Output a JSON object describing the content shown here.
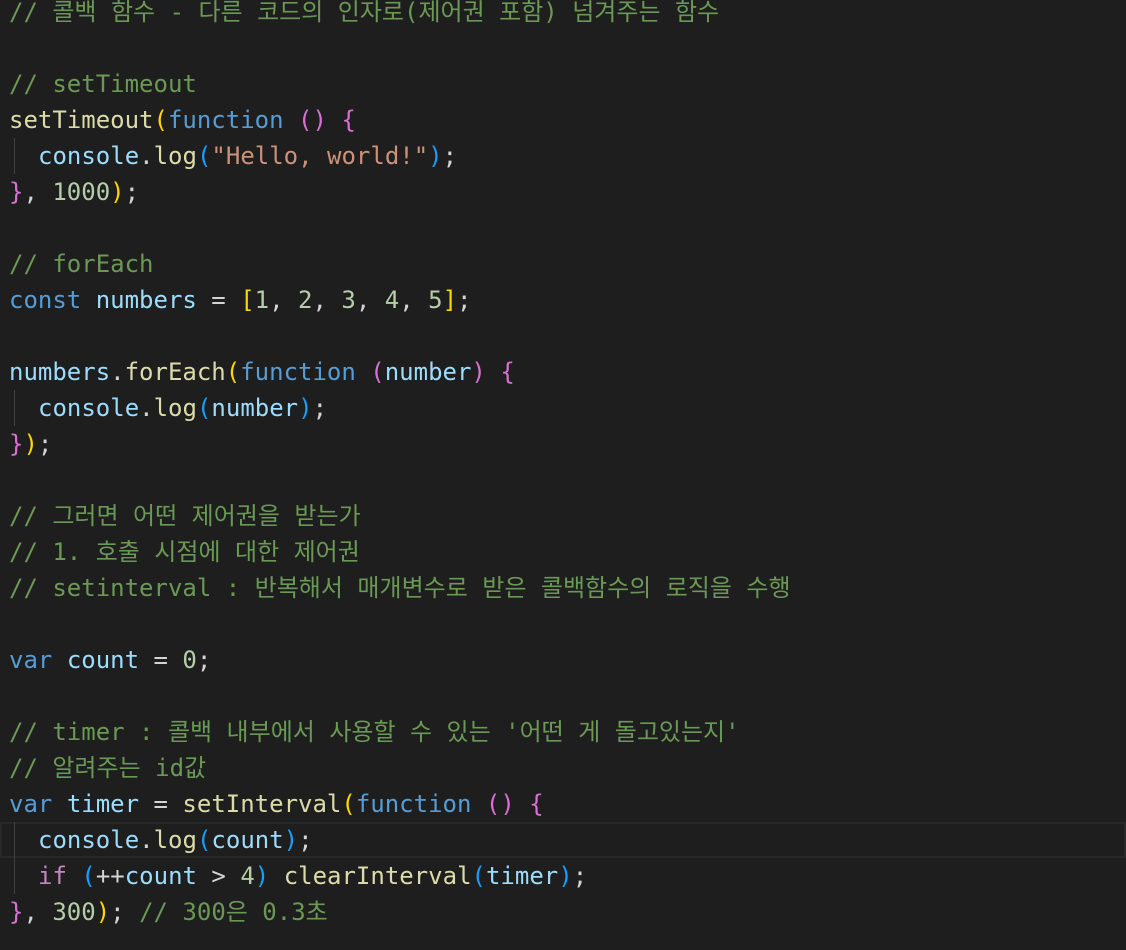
{
  "lines": [
    [
      {
        "t": "// 콜백 함수 - 다른 코드의 인자로(제어권 포함) 넘겨주는 함수",
        "c": "c"
      }
    ],
    [],
    [
      {
        "t": "// setTimeout",
        "c": "c"
      }
    ],
    [
      {
        "t": "setTimeout",
        "c": "f"
      },
      {
        "t": "(",
        "c": "b1"
      },
      {
        "t": "function",
        "c": "k"
      },
      {
        "t": " "
      },
      {
        "t": "()",
        "c": "b2"
      },
      {
        "t": " "
      },
      {
        "t": "{",
        "c": "b2"
      }
    ],
    [
      {
        "t": "console",
        "c": "v"
      },
      {
        "t": "."
      },
      {
        "t": "log",
        "c": "f"
      },
      {
        "t": "(",
        "c": "b3"
      },
      {
        "t": "\"Hello, world!\"",
        "c": "s"
      },
      {
        "t": ")",
        "c": "b3"
      },
      {
        "t": ";"
      }
    ],
    [
      {
        "t": "}",
        "c": "b2"
      },
      {
        "t": ", "
      },
      {
        "t": "1000",
        "c": "n"
      },
      {
        "t": ")",
        "c": "b1"
      },
      {
        "t": ";"
      }
    ],
    [],
    [
      {
        "t": "// forEach",
        "c": "c"
      }
    ],
    [
      {
        "t": "const",
        "c": "k"
      },
      {
        "t": " "
      },
      {
        "t": "numbers",
        "c": "v"
      },
      {
        "t": " = "
      },
      {
        "t": "[",
        "c": "b1"
      },
      {
        "t": "1",
        "c": "n"
      },
      {
        "t": ", "
      },
      {
        "t": "2",
        "c": "n"
      },
      {
        "t": ", "
      },
      {
        "t": "3",
        "c": "n"
      },
      {
        "t": ", "
      },
      {
        "t": "4",
        "c": "n"
      },
      {
        "t": ", "
      },
      {
        "t": "5",
        "c": "n"
      },
      {
        "t": "]",
        "c": "b1"
      },
      {
        "t": ";"
      }
    ],
    [],
    [
      {
        "t": "numbers",
        "c": "v"
      },
      {
        "t": "."
      },
      {
        "t": "forEach",
        "c": "f"
      },
      {
        "t": "(",
        "c": "b1"
      },
      {
        "t": "function",
        "c": "k"
      },
      {
        "t": " "
      },
      {
        "t": "(",
        "c": "b2"
      },
      {
        "t": "number",
        "c": "v"
      },
      {
        "t": ")",
        "c": "b2"
      },
      {
        "t": " "
      },
      {
        "t": "{",
        "c": "b2"
      }
    ],
    [
      {
        "t": "console",
        "c": "v"
      },
      {
        "t": "."
      },
      {
        "t": "log",
        "c": "f"
      },
      {
        "t": "(",
        "c": "b3"
      },
      {
        "t": "number",
        "c": "v"
      },
      {
        "t": ")",
        "c": "b3"
      },
      {
        "t": ";"
      }
    ],
    [
      {
        "t": "}",
        "c": "b2"
      },
      {
        "t": ")",
        "c": "b1"
      },
      {
        "t": ";"
      }
    ],
    [],
    [
      {
        "t": "// 그러면 어떤 제어권을 받는가",
        "c": "c"
      }
    ],
    [
      {
        "t": "// 1. 호출 시점에 대한 제어권",
        "c": "c"
      }
    ],
    [
      {
        "t": "// setinterval : 반복해서 매개변수로 받은 콜백함수의 로직을 수행",
        "c": "c"
      }
    ],
    [],
    [
      {
        "t": "var",
        "c": "k"
      },
      {
        "t": " "
      },
      {
        "t": "count",
        "c": "v"
      },
      {
        "t": " = "
      },
      {
        "t": "0",
        "c": "n"
      },
      {
        "t": ";"
      }
    ],
    [],
    [
      {
        "t": "// timer : 콜백 내부에서 사용할 수 있는 '어떤 게 돌고있는지'",
        "c": "c"
      }
    ],
    [
      {
        "t": "// 알려주는 id값",
        "c": "c"
      }
    ],
    [
      {
        "t": "var",
        "c": "k"
      },
      {
        "t": " "
      },
      {
        "t": "timer",
        "c": "v"
      },
      {
        "t": " = "
      },
      {
        "t": "setInterval",
        "c": "f"
      },
      {
        "t": "(",
        "c": "b1"
      },
      {
        "t": "function",
        "c": "k"
      },
      {
        "t": " "
      },
      {
        "t": "()",
        "c": "b2"
      },
      {
        "t": " "
      },
      {
        "t": "{",
        "c": "b2"
      }
    ],
    [
      {
        "t": "console",
        "c": "v"
      },
      {
        "t": "."
      },
      {
        "t": "log",
        "c": "f"
      },
      {
        "t": "(",
        "c": "b3"
      },
      {
        "t": "count",
        "c": "v"
      },
      {
        "t": ")",
        "c": "b3"
      },
      {
        "t": ";"
      }
    ],
    [
      {
        "t": "if",
        "c": "ctl"
      },
      {
        "t": " "
      },
      {
        "t": "(",
        "c": "b3"
      },
      {
        "t": "++",
        "c": "p"
      },
      {
        "t": "count",
        "c": "v"
      },
      {
        "t": " > "
      },
      {
        "t": "4",
        "c": "n"
      },
      {
        "t": ")",
        "c": "b3"
      },
      {
        "t": " "
      },
      {
        "t": "clearInterval",
        "c": "f"
      },
      {
        "t": "(",
        "c": "b3"
      },
      {
        "t": "timer",
        "c": "v"
      },
      {
        "t": ")",
        "c": "b3"
      },
      {
        "t": ";"
      }
    ],
    [
      {
        "t": "}",
        "c": "b2"
      },
      {
        "t": ", "
      },
      {
        "t": "300",
        "c": "n"
      },
      {
        "t": ")",
        "c": "b1"
      },
      {
        "t": "; "
      },
      {
        "t": "// 300은 0.3초",
        "c": "c"
      }
    ]
  ]
}
